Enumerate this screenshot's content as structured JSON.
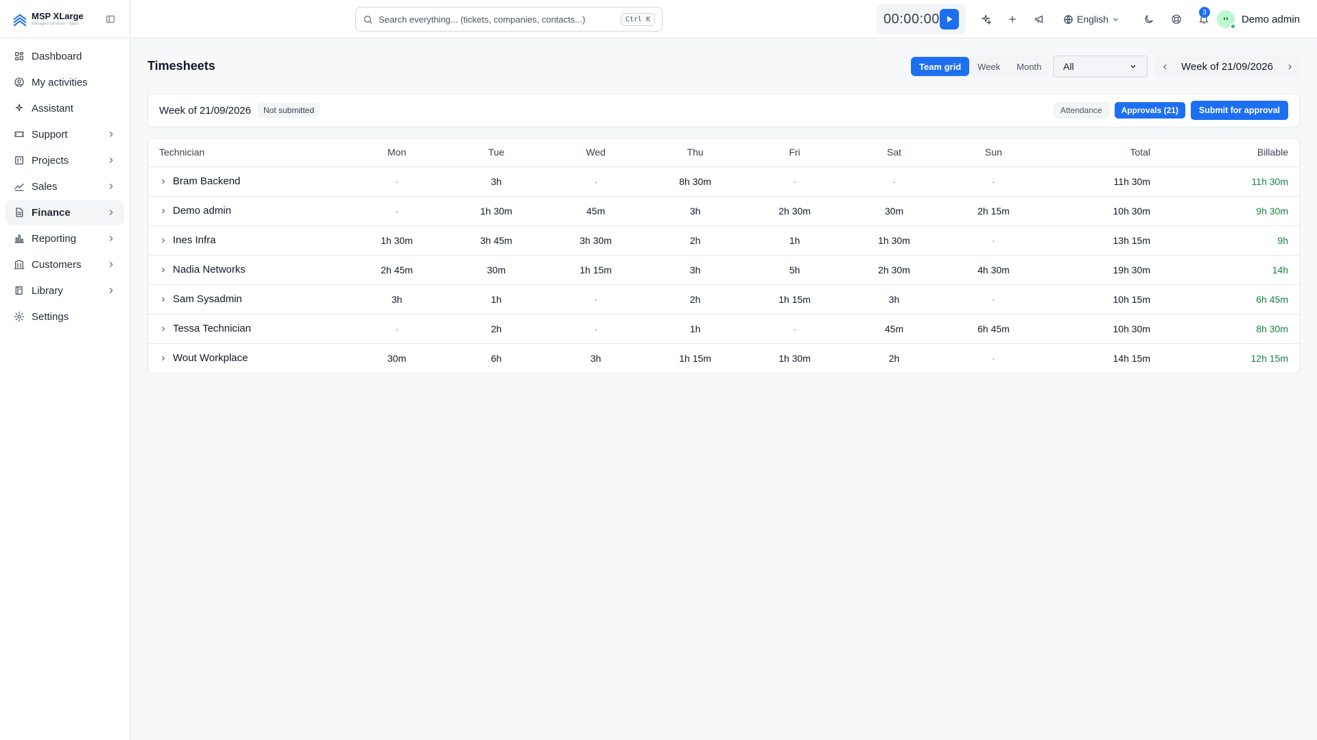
{
  "app": {
    "name": "MSP XLarge",
    "subtitle": "Managed services · SaaS"
  },
  "sidebar": {
    "items": [
      {
        "label": "Dashboard",
        "icon": "dashboard-icon",
        "expandable": false,
        "active": false
      },
      {
        "label": "My activities",
        "icon": "user-circle-icon",
        "expandable": false,
        "active": false
      },
      {
        "label": "Assistant",
        "icon": "sparkles-icon",
        "expandable": false,
        "active": false
      },
      {
        "label": "Support",
        "icon": "ticket-icon",
        "expandable": true,
        "active": false
      },
      {
        "label": "Projects",
        "icon": "projects-icon",
        "expandable": true,
        "active": false
      },
      {
        "label": "Sales",
        "icon": "chart-line-icon",
        "expandable": true,
        "active": false
      },
      {
        "label": "Finance",
        "icon": "document-icon",
        "expandable": true,
        "active": true
      },
      {
        "label": "Reporting",
        "icon": "bar-chart-icon",
        "expandable": true,
        "active": false
      },
      {
        "label": "Customers",
        "icon": "building-icon",
        "expandable": true,
        "active": false
      },
      {
        "label": "Library",
        "icon": "book-icon",
        "expandable": true,
        "active": false
      },
      {
        "label": "Settings",
        "icon": "gear-icon",
        "expandable": false,
        "active": false
      }
    ]
  },
  "topbar": {
    "search_placeholder": "Search everything... (tickets, companies, contacts...)",
    "search_shortcut": "Ctrl K",
    "timer": "00:00:00",
    "language": "English",
    "notifications_count": "3",
    "user_name": "Demo admin"
  },
  "page": {
    "title": "Timesheets",
    "view_tabs": [
      "Team grid",
      "Week",
      "Month"
    ],
    "active_view": "Team grid",
    "filter_value": "All",
    "week_label": "Week of 21/09/2026"
  },
  "week_card": {
    "label": "Week of 21/09/2026",
    "status": "Not submitted",
    "attendance_label": "Attendance",
    "approvals_label": "Approvals (21)",
    "submit_label": "Submit for approval"
  },
  "table": {
    "columns": [
      "Technician",
      "Mon",
      "Tue",
      "Wed",
      "Thu",
      "Fri",
      "Sat",
      "Sun",
      "Total",
      "Billable"
    ],
    "rows": [
      {
        "name": "Bram Backend",
        "days": [
          "·",
          "3h",
          "·",
          "8h 30m",
          "·",
          "·",
          "·"
        ],
        "total": "11h 30m",
        "billable": "11h 30m"
      },
      {
        "name": "Demo admin",
        "days": [
          "·",
          "1h 30m",
          "45m",
          "3h",
          "2h 30m",
          "30m",
          "2h 15m"
        ],
        "total": "10h 30m",
        "billable": "9h 30m"
      },
      {
        "name": "Ines Infra",
        "days": [
          "1h 30m",
          "3h 45m",
          "3h 30m",
          "2h",
          "1h",
          "1h 30m",
          "·"
        ],
        "total": "13h 15m",
        "billable": "9h"
      },
      {
        "name": "Nadia Networks",
        "days": [
          "2h 45m",
          "30m",
          "1h 15m",
          "3h",
          "5h",
          "2h 30m",
          "4h 30m"
        ],
        "total": "19h 30m",
        "billable": "14h"
      },
      {
        "name": "Sam Sysadmin",
        "days": [
          "3h",
          "1h",
          "·",
          "2h",
          "1h 15m",
          "3h",
          "·"
        ],
        "total": "10h 15m",
        "billable": "6h 45m"
      },
      {
        "name": "Tessa Technician",
        "days": [
          "·",
          "2h",
          "·",
          "1h",
          "·",
          "45m",
          "6h 45m"
        ],
        "total": "10h 30m",
        "billable": "8h 30m"
      },
      {
        "name": "Wout Workplace",
        "days": [
          "30m",
          "6h",
          "3h",
          "1h 15m",
          "1h 30m",
          "2h",
          "·"
        ],
        "total": "14h 15m",
        "billable": "12h 15m"
      }
    ]
  },
  "colors": {
    "accent": "#1d6ff2",
    "billable": "#15803d",
    "active_nav_bg": "#f3f4f6"
  }
}
